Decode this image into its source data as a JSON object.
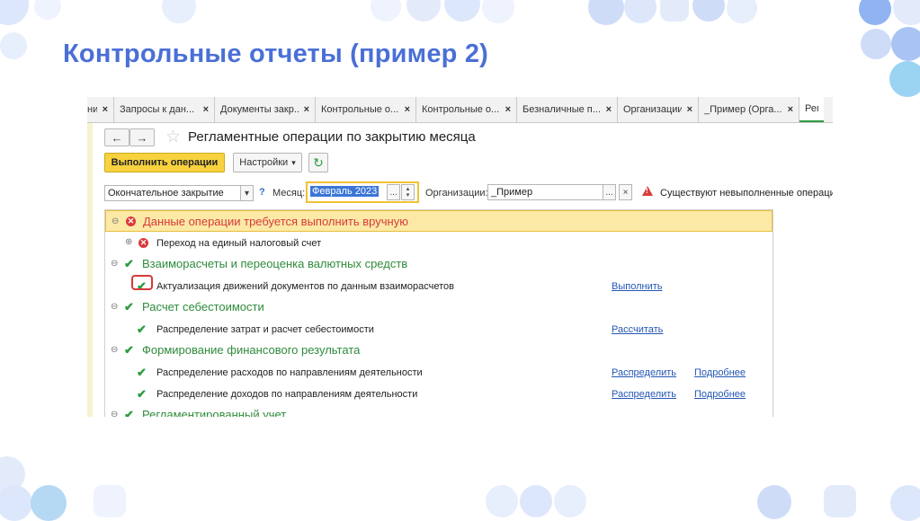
{
  "slide": {
    "title": "Контрольные отчеты (пример 2)"
  },
  "colors": {
    "title": "#4a6fd6",
    "primary_button": "#f7d23e",
    "ok_green": "#2e9b3e",
    "error_red": "#d93a3a",
    "highlight_row": "#fce9a6",
    "link": "#2356b3"
  },
  "tabs": [
    {
      "label": "ния",
      "close": "×"
    },
    {
      "label": "Запросы к дан...",
      "close": "×"
    },
    {
      "label": "Документы закр...",
      "close": "×"
    },
    {
      "label": "Контрольные о...",
      "close": "×"
    },
    {
      "label": "Контрольные о...",
      "close": "×"
    },
    {
      "label": "Безналичные п...",
      "close": "×"
    },
    {
      "label": "Организации",
      "close": "×"
    },
    {
      "label": "_Пример (Орга...",
      "close": "×"
    },
    {
      "label": "Регла",
      "close": ""
    }
  ],
  "window": {
    "back_icon": "←",
    "forward_icon": "→",
    "star_icon": "☆",
    "title": "Регламентные операции по закрытию месяца"
  },
  "toolbar": {
    "run_label": "Выполнить операции",
    "settings_label": "Настройки",
    "settings_arrow": "▾",
    "refresh_icon": "↻"
  },
  "filters": {
    "closing_type": "Окончательное закрытие",
    "closing_arrow": "▾",
    "help": "?",
    "month_label": "Месяц:",
    "month_value": "Февраль 2023",
    "month_dots": "...",
    "month_spin_up": "▴",
    "month_spin_down": "▾",
    "org_label": "Организации:",
    "org_value": "_Пример",
    "org_dots": "...",
    "org_clear": "×",
    "warning": "Существуют невыполненные операции"
  },
  "tree": {
    "groups": [
      {
        "expander": "⊖",
        "status": "error",
        "label": "Данные операции требуется выполнить вручную"
      },
      {
        "expander": "⊖",
        "status": "ok",
        "label": "Взаиморасчеты и переоценка валютных средств"
      },
      {
        "expander": "⊖",
        "status": "ok",
        "label": "Расчет себестоимости"
      },
      {
        "expander": "⊖",
        "status": "ok",
        "label": "Формирование финансового результата"
      },
      {
        "expander": "⊖",
        "status": "ok",
        "label": "Регламентированный учет"
      }
    ],
    "items": [
      {
        "expander": "⊕",
        "status": "error",
        "label": "Переход на единый налоговый счет",
        "action": "",
        "details": ""
      },
      {
        "status": "ok",
        "label": "Актуализация движений документов по данным взаиморасчетов",
        "action": "Выполнить",
        "details": ""
      },
      {
        "status": "ok",
        "label": "Распределение затрат и расчет себестоимости",
        "action": "Рассчитать",
        "details": ""
      },
      {
        "status": "ok",
        "label": "Распределение расходов по направлениям деятельности",
        "action": "Распределить",
        "details": "Подробнее"
      },
      {
        "status": "ok",
        "label": "Распределение доходов по направлениям деятельности",
        "action": "Распределить",
        "details": "Подробнее"
      }
    ],
    "check_icon": "✔",
    "error_icon": "✕"
  }
}
